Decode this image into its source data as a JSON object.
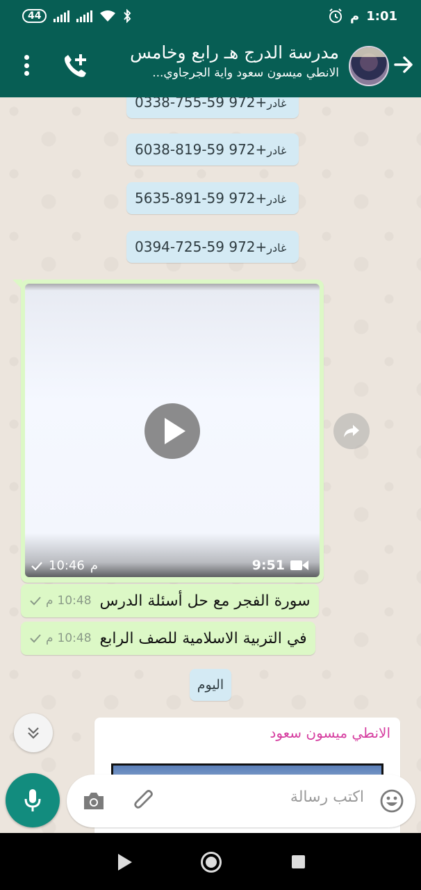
{
  "status_bar": {
    "battery": "44",
    "time": "1:01",
    "time_suffix": "م"
  },
  "header": {
    "title": "مدرسة الدرج هـ رابع وخامس",
    "subtitle": "الانطي ميسون سعود واية الجرجاوي...",
    "icons": [
      "arrow-forward-icon",
      "group-avatar",
      "add-call-icon",
      "more-vert-icon"
    ]
  },
  "system_messages": [
    {
      "number": "+972 59-755-0338",
      "who": "غادر"
    },
    {
      "number": "+972 59-819-6038",
      "who": "غادر"
    },
    {
      "number": "+972 59-891-5635",
      "who": "غادر"
    },
    {
      "number": "+972 59-725-0394",
      "who": "غادر"
    }
  ],
  "video_message": {
    "time": "10:46",
    "time_suffix": "م",
    "duration": "9:51"
  },
  "text_messages": [
    {
      "text": "سورة الفجر مع حل أسئلة الدرس",
      "time": "10:48",
      "time_suffix": "م"
    },
    {
      "text": "في التربية الاسلامية للصف الرابع",
      "time": "10:48",
      "time_suffix": "م"
    }
  ],
  "day_divider": "اليوم",
  "incoming": {
    "sender": "الانطي ميسون سعود"
  },
  "composer": {
    "placeholder": "اكتب رسالة"
  },
  "colors": {
    "header": "#075e54",
    "accent": "#128c7e",
    "outgoing_bubble": "#dcf8c6",
    "system_bubble": "#d4eaf4",
    "sender_name": "#d63ea0"
  }
}
